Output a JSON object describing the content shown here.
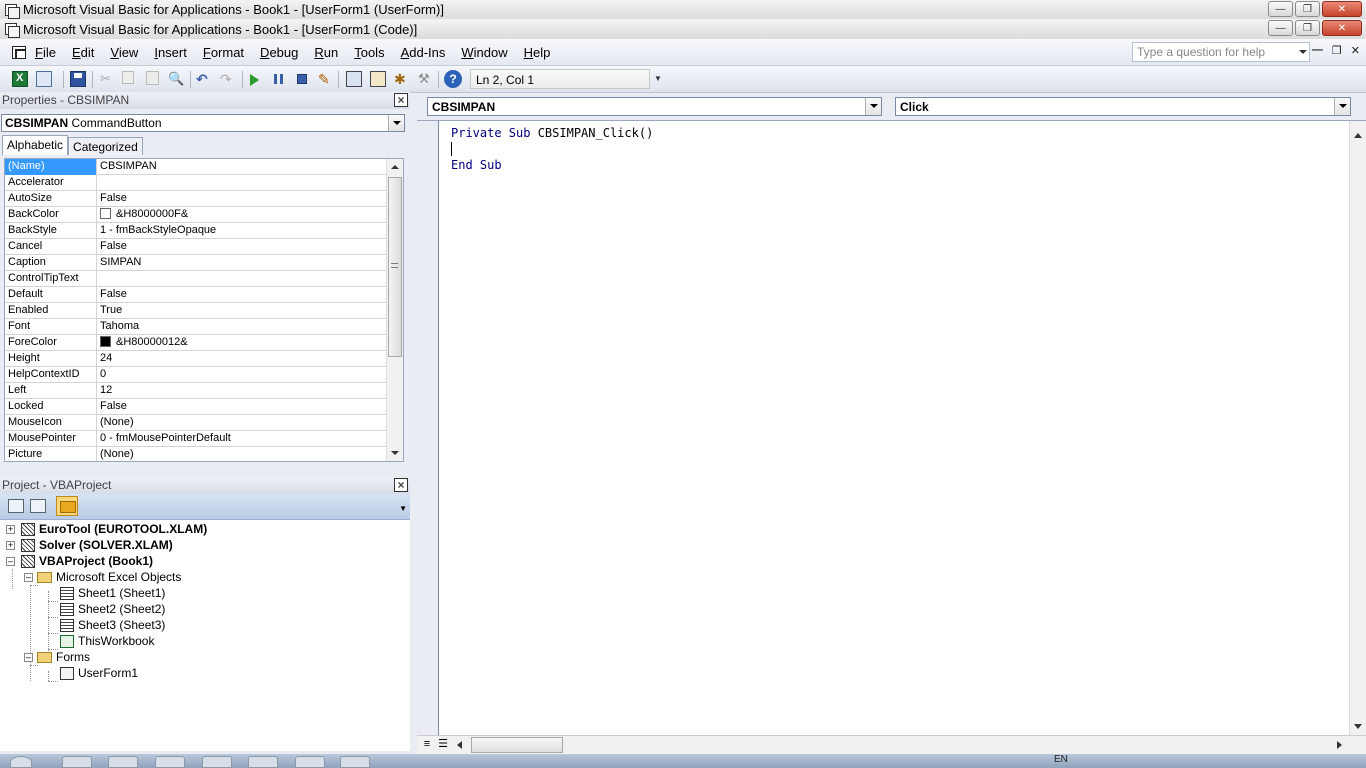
{
  "windows": {
    "back_title": "Microsoft Visual Basic for Applications - Book1 - [UserForm1 (UserForm)]",
    "front_title": "Microsoft Visual Basic for Applications - Book1 - [UserForm1 (Code)]"
  },
  "menu": {
    "items": [
      "File",
      "Edit",
      "View",
      "Insert",
      "Format",
      "Debug",
      "Run",
      "Tools",
      "Add-Ins",
      "Window",
      "Help"
    ],
    "help_placeholder": "Type a question for help"
  },
  "toolbar": {
    "cursor_position": "Ln 2, Col 1"
  },
  "properties": {
    "title": "Properties - CBSIMPAN",
    "object_name": "CBSIMPAN",
    "object_type": "CommandButton",
    "tabs": [
      "Alphabetic",
      "Categorized"
    ],
    "rows": [
      {
        "name": "(Name)",
        "value": "CBSIMPAN"
      },
      {
        "name": "Accelerator",
        "value": ""
      },
      {
        "name": "AutoSize",
        "value": "False"
      },
      {
        "name": "BackColor",
        "value": "&H8000000F&"
      },
      {
        "name": "BackStyle",
        "value": "1 - fmBackStyleOpaque"
      },
      {
        "name": "Cancel",
        "value": "False"
      },
      {
        "name": "Caption",
        "value": "SIMPAN"
      },
      {
        "name": "ControlTipText",
        "value": ""
      },
      {
        "name": "Default",
        "value": "False"
      },
      {
        "name": "Enabled",
        "value": "True"
      },
      {
        "name": "Font",
        "value": "Tahoma"
      },
      {
        "name": "ForeColor",
        "value": "&H80000012&"
      },
      {
        "name": "Height",
        "value": "24"
      },
      {
        "name": "HelpContextID",
        "value": "0"
      },
      {
        "name": "Left",
        "value": "12"
      },
      {
        "name": "Locked",
        "value": "False"
      },
      {
        "name": "MouseIcon",
        "value": "(None)"
      },
      {
        "name": "MousePointer",
        "value": "0 - fmMousePointerDefault"
      },
      {
        "name": "Picture",
        "value": "(None)"
      }
    ],
    "colors": {
      "backcolor_swatch": "#ffffff",
      "forecolor_swatch": "#000000",
      "selection": "#3399ff"
    }
  },
  "project": {
    "title": "Project - VBAProject",
    "nodes": {
      "eurotool": "EuroTool (EUROTOOL.XLAM)",
      "solver": "Solver (SOLVER.XLAM)",
      "vbaproject": "VBAProject (Book1)",
      "excel_objects": "Microsoft Excel Objects",
      "sheet1": "Sheet1 (Sheet1)",
      "sheet2": "Sheet2 (Sheet2)",
      "sheet3": "Sheet3 (Sheet3)",
      "thisworkbook": "ThisWorkbook",
      "forms": "Forms",
      "userform1": "UserForm1"
    }
  },
  "code": {
    "object_combo": "CBSIMPAN",
    "procedure_combo": "Click",
    "line1_kw": "Private Sub",
    "line1_rest": " CBSIMPAN_Click()",
    "line3_kw": "End Sub",
    "keyword_color": "#00007f"
  },
  "tray": {
    "language": "EN"
  }
}
